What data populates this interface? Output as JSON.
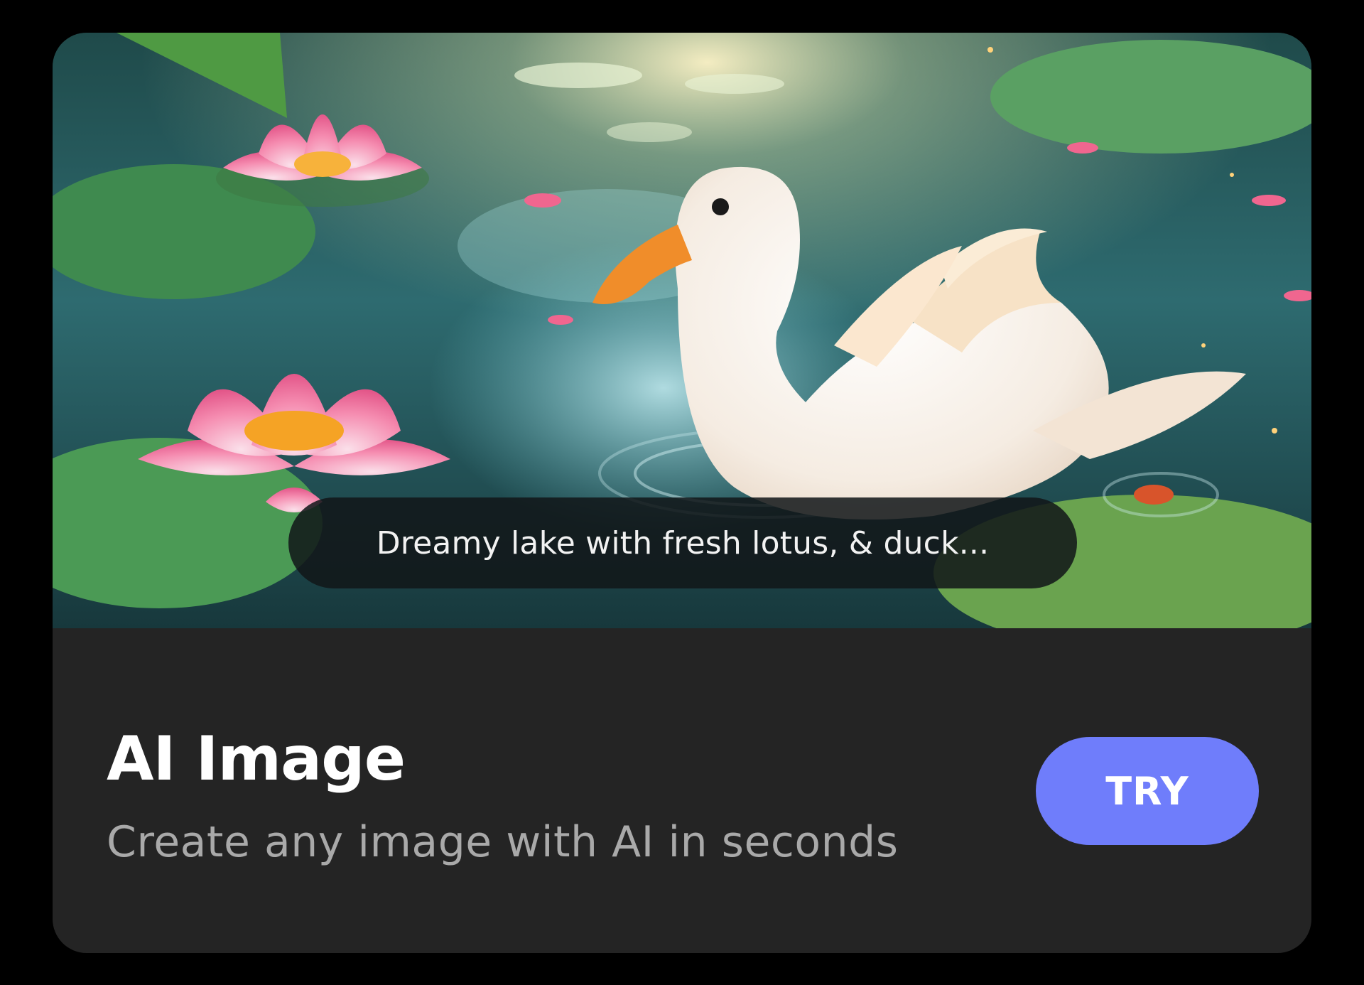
{
  "card": {
    "prompt_text": "Dreamy lake with fresh lotus, & duck...",
    "title": "AI Image",
    "subtitle": "Create any image with AI in seconds",
    "try_label": "TRY"
  },
  "colors": {
    "background": "#000000",
    "card_background": "#242424",
    "button_accent": "#6f7dfb",
    "subtitle_text": "#a9a9a9"
  },
  "icons": {
    "hero_image": "lotus-lake-duck-illustration"
  }
}
